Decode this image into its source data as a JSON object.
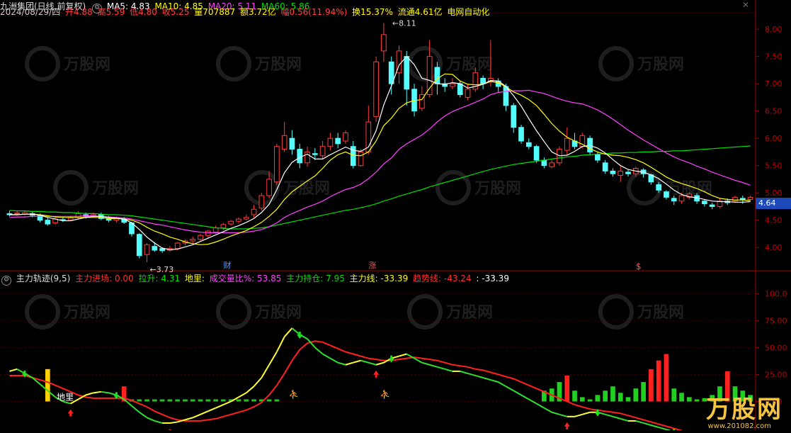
{
  "price_header": {
    "stock": "九洲集团(日线,前复权)",
    "ma5": "MA5: 4.83",
    "ma10": "MA10: 4.85",
    "ma20": "MA20: 5.11",
    "ma60": "MA60: 5.86",
    "date": "2024/08/29/四",
    "open": "开4.88",
    "high": "高5.59",
    "low": "低4.80",
    "close": "收5.25",
    "volume": "量707887",
    "amount": "额3.72亿",
    "change": "幅0.56(11.94%)",
    "turnover": "换15.37%",
    "float": "流通4.61亿",
    "sector": "电网自动化"
  },
  "indicator_header": {
    "name": "主力轨迹(9,5)",
    "entry": "主力进场: 0.00",
    "pull": "拉升: 4.31",
    "ground": "地里:",
    "vol_ratio": "成交量比%: 53.85",
    "hold": "主力持仓: 7.95",
    "main_line": "主力线: -33.39",
    "trend_line": "趋势线: -43.24",
    "extra": ": -33.39"
  },
  "colors": {
    "up": "#ff3c3c",
    "down": "#54ffff",
    "ma5": "#ffffff",
    "ma10": "#ffff00",
    "ma20": "#ff40ff",
    "ma60": "#00e000",
    "axis": "#a00000"
  },
  "price_axis": {
    "ticks": [
      "8.00",
      "7.50",
      "7.00",
      "6.50",
      "6.00",
      "5.50",
      "5.00",
      "4.50",
      "4.00"
    ],
    "range": [
      3.6,
      8.3
    ]
  },
  "current_price": "4.64",
  "annotations": {
    "high": "8.11",
    "low": "3.73",
    "m1": "财",
    "m2": "涨",
    "m3": "$",
    "ground_label": "地里"
  },
  "indicator_axis": {
    "ticks": [
      "100.0",
      "75.00",
      "50.00",
      "25.00",
      "0.00"
    ],
    "range": [
      -22,
      112
    ]
  },
  "watermark": {
    "brand": "万股网",
    "url": "www.201082.com"
  },
  "chart_data": {
    "type": "candlestick",
    "candles": [
      [
        4.62,
        4.6,
        4.67,
        4.57
      ],
      [
        4.62,
        4.63,
        4.67,
        4.58
      ],
      [
        4.61,
        4.64,
        4.67,
        4.58
      ],
      [
        4.62,
        4.59,
        4.66,
        4.55
      ],
      [
        4.59,
        4.5,
        4.62,
        4.46
      ],
      [
        4.5,
        4.43,
        4.54,
        4.4
      ],
      [
        4.45,
        4.52,
        4.55,
        4.42
      ],
      [
        4.51,
        4.5,
        4.56,
        4.47
      ],
      [
        4.5,
        4.54,
        4.58,
        4.48
      ],
      [
        4.55,
        4.62,
        4.66,
        4.52
      ],
      [
        4.6,
        4.57,
        4.64,
        4.53
      ],
      [
        4.57,
        4.6,
        4.64,
        4.54
      ],
      [
        4.6,
        4.53,
        4.64,
        4.5
      ],
      [
        4.53,
        4.5,
        4.58,
        4.46
      ],
      [
        4.5,
        4.53,
        4.57,
        4.46
      ],
      [
        4.52,
        4.46,
        4.56,
        4.43
      ],
      [
        4.45,
        4.25,
        4.47,
        4.2
      ],
      [
        4.24,
        3.85,
        4.26,
        3.8
      ],
      [
        3.87,
        4.05,
        4.08,
        3.73
      ],
      [
        4.02,
        3.95,
        4.1,
        3.92
      ],
      [
        3.98,
        3.94,
        4.0,
        3.9
      ],
      [
        3.95,
        3.98,
        4.03,
        3.92
      ],
      [
        3.98,
        4.08,
        4.1,
        3.95
      ],
      [
        4.08,
        4.12,
        4.15,
        4.04
      ],
      [
        4.12,
        4.15,
        4.2,
        4.08
      ],
      [
        4.15,
        4.22,
        4.25,
        4.12
      ],
      [
        4.22,
        4.3,
        4.32,
        4.18
      ],
      [
        4.28,
        4.36,
        4.4,
        4.25
      ],
      [
        4.36,
        4.42,
        4.45,
        4.32
      ],
      [
        4.43,
        4.48,
        4.5,
        4.4
      ],
      [
        4.48,
        4.52,
        4.55,
        4.44
      ],
      [
        4.52,
        4.55,
        4.6,
        4.5
      ],
      [
        4.6,
        4.7,
        4.78,
        4.55
      ],
      [
        4.72,
        4.95,
        5.0,
        4.68
      ],
      [
        4.95,
        5.25,
        5.4,
        4.9
      ],
      [
        5.2,
        5.85,
        5.9,
        5.15
      ],
      [
        5.8,
        6.05,
        6.3,
        5.75
      ],
      [
        6.0,
        5.8,
        6.15,
        5.7
      ],
      [
        5.8,
        5.55,
        5.9,
        5.45
      ],
      [
        5.55,
        5.75,
        5.85,
        5.48
      ],
      [
        5.72,
        5.7,
        5.82,
        5.6
      ],
      [
        5.68,
        5.85,
        5.95,
        5.62
      ],
      [
        5.85,
        6.0,
        6.1,
        5.78
      ],
      [
        6.0,
        5.9,
        6.1,
        5.82
      ],
      [
        5.95,
        6.1,
        6.15,
        5.9
      ],
      [
        5.85,
        5.5,
        5.95,
        5.45
      ],
      [
        5.5,
        5.75,
        5.8,
        5.48
      ],
      [
        5.75,
        6.3,
        6.6,
        5.7
      ],
      [
        6.4,
        7.4,
        7.5,
        6.3
      ],
      [
        7.6,
        7.9,
        8.11,
        7.4
      ],
      [
        7.4,
        7.0,
        7.5,
        6.8
      ],
      [
        7.2,
        7.6,
        7.7,
        7.0
      ],
      [
        7.5,
        6.9,
        7.6,
        6.6
      ],
      [
        6.9,
        6.5,
        7.0,
        6.4
      ],
      [
        6.55,
        6.8,
        6.95,
        6.5
      ],
      [
        6.8,
        7.5,
        7.8,
        6.75
      ],
      [
        7.3,
        7.0,
        7.4,
        6.8
      ],
      [
        7.0,
        6.95,
        7.1,
        6.85
      ],
      [
        6.95,
        7.0,
        7.1,
        6.9
      ],
      [
        7.0,
        6.8,
        7.05,
        6.75
      ],
      [
        6.75,
        6.9,
        7.0,
        6.7
      ],
      [
        6.9,
        7.2,
        7.3,
        6.85
      ],
      [
        7.1,
        7.0,
        7.15,
        6.9
      ],
      [
        7.05,
        7.1,
        7.8,
        6.95
      ],
      [
        7.05,
        6.95,
        7.1,
        6.85
      ],
      [
        6.95,
        6.6,
        7.0,
        6.5
      ],
      [
        6.6,
        6.2,
        6.65,
        6.1
      ],
      [
        6.2,
        5.95,
        6.25,
        5.9
      ],
      [
        5.92,
        5.85,
        6.0,
        5.8
      ],
      [
        5.85,
        5.6,
        5.88,
        5.55
      ],
      [
        5.6,
        5.5,
        5.65,
        5.45
      ],
      [
        5.48,
        5.55,
        5.6,
        5.45
      ],
      [
        5.55,
        5.8,
        5.85,
        5.5
      ],
      [
        5.78,
        6.0,
        6.2,
        5.7
      ],
      [
        5.95,
        5.85,
        6.1,
        5.8
      ],
      [
        5.85,
        6.05,
        6.1,
        5.82
      ],
      [
        6.0,
        5.75,
        6.05,
        5.7
      ],
      [
        5.7,
        5.6,
        5.75,
        5.55
      ],
      [
        5.55,
        5.4,
        5.6,
        5.35
      ],
      [
        5.4,
        5.35,
        5.45,
        5.3
      ],
      [
        5.32,
        5.4,
        5.5,
        5.2
      ],
      [
        5.38,
        5.35,
        5.42,
        5.3
      ],
      [
        5.35,
        5.45,
        5.48,
        5.3
      ],
      [
        5.42,
        5.35,
        5.45,
        5.28
      ],
      [
        5.33,
        5.2,
        5.35,
        5.15
      ],
      [
        5.15,
        5.05,
        5.2,
        5.0
      ],
      [
        5.02,
        4.92,
        5.05,
        4.88
      ],
      [
        4.9,
        4.85,
        4.95,
        4.78
      ],
      [
        4.85,
        4.95,
        5.0,
        4.8
      ],
      [
        4.92,
        4.98,
        5.02,
        4.88
      ],
      [
        4.95,
        4.85,
        5.0,
        4.8
      ],
      [
        4.85,
        4.8,
        4.88,
        4.75
      ],
      [
        4.78,
        4.75,
        4.82,
        4.7
      ],
      [
        4.75,
        4.85,
        4.9,
        4.72
      ],
      [
        4.85,
        4.82,
        4.9,
        4.78
      ],
      [
        4.85,
        4.92,
        4.95,
        4.82
      ],
      [
        4.9,
        4.88,
        4.95,
        4.8
      ],
      [
        4.88,
        4.92,
        4.95,
        4.85
      ]
    ],
    "ma5": [
      4.6,
      4.6,
      4.61,
      4.61,
      4.59,
      4.55,
      4.52,
      4.49,
      4.49,
      4.52,
      4.55,
      4.57,
      4.57,
      4.55,
      4.54,
      4.52,
      4.45,
      4.33,
      4.19,
      4.08,
      3.99,
      3.96,
      3.97,
      4.01,
      4.05,
      4.11,
      4.17,
      4.23,
      4.29,
      4.35,
      4.4,
      4.46,
      4.53,
      4.64,
      4.79,
      5.06,
      5.37,
      5.56,
      5.65,
      5.71,
      5.62,
      5.62,
      5.7,
      5.77,
      5.84,
      5.78,
      5.76,
      5.84,
      6.14,
      6.61,
      6.96,
      7.34,
      7.5,
      7.35,
      7.1,
      7.06,
      7.0,
      6.99,
      7.02,
      7.0,
      6.92,
      6.95,
      6.99,
      7.06,
      7.05,
      6.95,
      6.78,
      6.59,
      6.36,
      6.14,
      5.94,
      5.75,
      5.68,
      5.69,
      5.76,
      5.85,
      5.87,
      5.82,
      5.73,
      5.61,
      5.5,
      5.43,
      5.4,
      5.38,
      5.33,
      5.26,
      5.16,
      5.05,
      4.97,
      4.93,
      4.91,
      4.88,
      4.85,
      4.84,
      4.84,
      4.83,
      4.83,
      4.84
    ],
    "ma10": [
      4.6,
      4.6,
      4.61,
      4.61,
      4.6,
      4.58,
      4.56,
      4.55,
      4.55,
      4.55,
      4.55,
      4.55,
      4.55,
      4.53,
      4.53,
      4.52,
      4.5,
      4.45,
      4.37,
      4.3,
      4.25,
      4.19,
      4.15,
      4.1,
      4.07,
      4.05,
      4.06,
      4.1,
      4.15,
      4.21,
      4.26,
      4.31,
      4.38,
      4.46,
      4.57,
      4.7,
      4.88,
      5.02,
      5.12,
      5.22,
      5.31,
      5.45,
      5.6,
      5.7,
      5.75,
      5.69,
      5.68,
      5.75,
      5.95,
      6.23,
      6.37,
      6.55,
      6.65,
      6.69,
      6.71,
      6.92,
      7.09,
      7.18,
      7.17,
      7.05,
      6.99,
      6.98,
      6.99,
      7.04,
      7.02,
      6.94,
      6.85,
      6.79,
      6.71,
      6.6,
      6.44,
      6.27,
      6.13,
      6.02,
      5.95,
      5.89,
      5.81,
      5.75,
      5.71,
      5.69,
      5.68,
      5.65,
      5.61,
      5.55,
      5.47,
      5.38,
      5.29,
      5.22,
      5.17,
      5.13,
      5.08,
      5.02,
      4.95,
      4.9,
      4.88,
      4.87,
      4.87,
      4.86
    ],
    "ma20": [
      4.55,
      4.56,
      4.56,
      4.57,
      4.57,
      4.57,
      4.57,
      4.57,
      4.57,
      4.57,
      4.58,
      4.58,
      4.57,
      4.56,
      4.55,
      4.54,
      4.52,
      4.49,
      4.46,
      4.43,
      4.41,
      4.38,
      4.35,
      4.32,
      4.3,
      4.28,
      4.27,
      4.27,
      4.27,
      4.27,
      4.27,
      4.28,
      4.3,
      4.33,
      4.38,
      4.45,
      4.55,
      4.62,
      4.68,
      4.74,
      4.79,
      4.85,
      4.93,
      5.0,
      5.06,
      5.1,
      5.16,
      5.26,
      5.38,
      5.53,
      5.64,
      5.8,
      5.9,
      5.98,
      6.06,
      6.17,
      6.3,
      6.41,
      6.49,
      6.55,
      6.6,
      6.66,
      6.72,
      6.8,
      6.84,
      6.86,
      6.87,
      6.87,
      6.88,
      6.85,
      6.82,
      6.77,
      6.72,
      6.68,
      6.65,
      6.63,
      6.58,
      6.52,
      6.44,
      6.35,
      6.25,
      6.15,
      6.06,
      5.97,
      5.89,
      5.81,
      5.73,
      5.66,
      5.6,
      5.55,
      5.49,
      5.44,
      5.38,
      5.33,
      5.28,
      5.23,
      5.19,
      5.14
    ],
    "ma60": [
      4.68,
      4.67,
      4.67,
      4.66,
      4.66,
      4.65,
      4.65,
      4.64,
      4.64,
      4.63,
      4.62,
      4.62,
      4.61,
      4.6,
      4.6,
      4.59,
      4.58,
      4.56,
      4.54,
      4.52,
      4.5,
      4.48,
      4.46,
      4.44,
      4.42,
      4.4,
      4.38,
      4.36,
      4.35,
      4.34,
      4.34,
      4.34,
      4.35,
      4.36,
      4.38,
      4.41,
      4.44,
      4.47,
      4.5,
      4.53,
      4.56,
      4.59,
      4.62,
      4.65,
      4.68,
      4.7,
      4.73,
      4.76,
      4.8,
      4.85,
      4.89,
      4.94,
      4.98,
      5.02,
      5.06,
      5.11,
      5.15,
      5.19,
      5.23,
      5.27,
      5.31,
      5.35,
      5.39,
      5.43,
      5.46,
      5.49,
      5.52,
      5.54,
      5.56,
      5.58,
      5.6,
      5.62,
      5.64,
      5.66,
      5.67,
      5.69,
      5.7,
      5.71,
      5.72,
      5.73,
      5.73,
      5.74,
      5.74,
      5.75,
      5.75,
      5.76,
      5.76,
      5.77,
      5.77,
      5.78,
      5.79,
      5.8,
      5.81,
      5.82,
      5.83,
      5.84,
      5.85,
      5.86
    ],
    "indicator": {
      "main_line": [
        28,
        30,
        26,
        22,
        16,
        10,
        4,
        0,
        -2,
        2,
        6,
        8,
        9,
        8,
        6,
        2,
        -4,
        -10,
        -15,
        -18,
        -20,
        -20,
        -19,
        -17,
        -15,
        -12,
        -9,
        -6,
        -3,
        0,
        4,
        8,
        14,
        22,
        34,
        46,
        60,
        68,
        62,
        58,
        50,
        44,
        40,
        36,
        34,
        36,
        38,
        36,
        34,
        36,
        40,
        42,
        44,
        40,
        36,
        34,
        32,
        30,
        28,
        28,
        26,
        24,
        22,
        20,
        18,
        14,
        10,
        6,
        2,
        -2,
        -6,
        -10,
        -12,
        -14,
        -14,
        -12,
        -10,
        -10,
        -12,
        -14,
        -16,
        -18,
        -18,
        -20,
        -22,
        -24,
        -26,
        -28,
        -28,
        -30,
        -30,
        -32,
        -33,
        -32,
        -30,
        -32,
        -33,
        -33
      ],
      "trend_line": [
        24,
        24,
        24,
        22,
        20,
        18,
        15,
        12,
        9,
        6,
        4,
        3,
        3,
        3,
        3,
        3,
        1,
        -2,
        -5,
        -9,
        -12,
        -15,
        -17,
        -18,
        -18,
        -18,
        -17,
        -16,
        -14,
        -12,
        -10,
        -8,
        -5,
        -1,
        6,
        15,
        26,
        38,
        48,
        54,
        56,
        55,
        52,
        49,
        46,
        44,
        42,
        40,
        39,
        38,
        38,
        39,
        40,
        41,
        40,
        39,
        38,
        36,
        34,
        33,
        32,
        30,
        29,
        27,
        25,
        23,
        21,
        18,
        15,
        12,
        9,
        6,
        3,
        0,
        -3,
        -5,
        -7,
        -8,
        -9,
        -10,
        -11,
        -13,
        -15,
        -17,
        -19,
        -21,
        -23,
        -25,
        -27,
        -29,
        -31,
        -33,
        -35,
        -37,
        -39,
        -41,
        -42,
        -43
      ],
      "histogram_tail": [
        10,
        12,
        18,
        24,
        10,
        4,
        2,
        -6,
        -10,
        -14,
        -8,
        4,
        12,
        18,
        30,
        38,
        44,
        12,
        8,
        4,
        2,
        3,
        6,
        14,
        28,
        14,
        10,
        6
      ]
    }
  }
}
